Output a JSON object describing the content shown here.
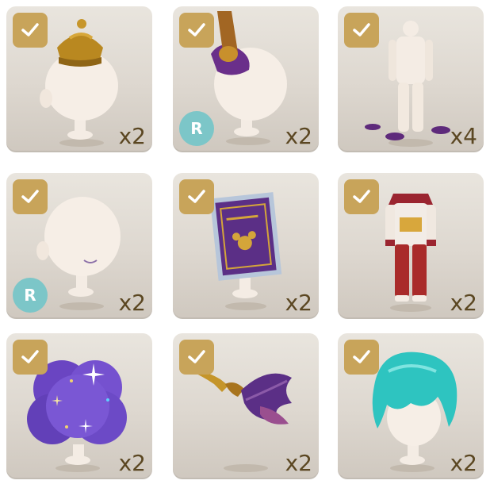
{
  "colors": {
    "card_bg": "#ddd7cf",
    "check_badge": "#c8a45a",
    "rare_badge": "#7cc6c8",
    "quantity_text": "#5b4722"
  },
  "items": [
    {
      "name": "gold-crown",
      "quantity": "x2",
      "rarity_badge": "",
      "owned": true,
      "icon": "crown-icon"
    },
    {
      "name": "purple-feather-hat-accessory",
      "quantity": "x2",
      "rarity_badge": "R",
      "owned": true,
      "icon": "hat-accessory-icon"
    },
    {
      "name": "white-outfit-with-purple-puddles",
      "quantity": "x4",
      "rarity_badge": "",
      "owned": true,
      "icon": "outfit-icon"
    },
    {
      "name": "face-smile",
      "quantity": "x2",
      "rarity_badge": "R",
      "owned": true,
      "icon": "face-icon"
    },
    {
      "name": "purple-stamp-card",
      "quantity": "x2",
      "rarity_badge": "",
      "owned": true,
      "icon": "stamp-icon"
    },
    {
      "name": "red-white-uniform",
      "quantity": "x2",
      "rarity_badge": "",
      "owned": true,
      "icon": "uniform-icon"
    },
    {
      "name": "purple-sparkle-background",
      "quantity": "x2",
      "rarity_badge": "",
      "owned": true,
      "icon": "sparkle-cloud-icon"
    },
    {
      "name": "feather-quill",
      "quantity": "x2",
      "rarity_badge": "",
      "owned": true,
      "icon": "quill-icon"
    },
    {
      "name": "teal-hair",
      "quantity": "x2",
      "rarity_badge": "",
      "owned": true,
      "icon": "hair-icon"
    }
  ]
}
